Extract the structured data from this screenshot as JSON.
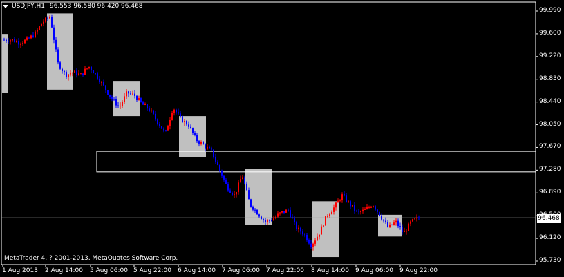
{
  "header": {
    "symbol_timeframe": "USDJPY,H1",
    "ohlc": "96.553 96.580 96.420 96.468"
  },
  "footer": {
    "copyright": "MetaTrader 4, ? 2001-2013, MetaQuotes Software Corp."
  },
  "colors": {
    "background": "#000000",
    "bull_candle": "#ff0000",
    "bear_candle": "#0000ff",
    "grid_and_axis": "#ffffff",
    "highlight_box": "#c0c0c0"
  },
  "current_price_label": "96.468",
  "chart_data": {
    "type": "candlestick",
    "title": "USDJPY,H1",
    "y_ticks": [
      "99.990",
      "99.600",
      "99.220",
      "98.830",
      "98.440",
      "98.050",
      "97.670",
      "97.280",
      "96.890",
      "96.500",
      "96.120",
      "95.730"
    ],
    "x_ticks": [
      "1 Aug 2013",
      "2 Aug 14:00",
      "5 Aug 06:00",
      "5 Aug 22:00",
      "6 Aug 14:00",
      "7 Aug 06:00",
      "7 Aug 22:00",
      "8 Aug 14:00",
      "9 Aug 06:00",
      "9 Aug 22:00"
    ],
    "ylim": [
      95.7,
      100.1
    ],
    "current_price": 96.468,
    "support_resistance_zone": [
      97.25,
      97.6
    ],
    "price_path": [
      99.5,
      99.5,
      99.45,
      99.5,
      99.6,
      99.8,
      99.9,
      99.1,
      98.9,
      98.95,
      98.9,
      99.05,
      98.9,
      98.7,
      98.5,
      98.35,
      98.6,
      98.55,
      98.4,
      98.3,
      98.1,
      97.9,
      98.35,
      98.15,
      98.05,
      97.8,
      97.7,
      97.6,
      97.3,
      97.0,
      96.85,
      97.2,
      96.7,
      96.55,
      96.4,
      96.45,
      96.55,
      96.6,
      96.3,
      96.2,
      96.0,
      96.2,
      96.5,
      96.65,
      96.85,
      96.7,
      96.55,
      96.6,
      96.7,
      96.5,
      96.3,
      96.4,
      96.2,
      96.4,
      96.468
    ],
    "highlight_boxes": [
      {
        "from": "1 Aug 2013",
        "to": "1 Aug 2013",
        "high": 99.6,
        "low": 98.6
      },
      {
        "from": "2 Aug 14:00",
        "to": "2 Aug 14:00",
        "high": 99.95,
        "low": 98.65
      },
      {
        "from": "5 Aug 06:00",
        "to": "5 Aug 22:00",
        "high": 98.8,
        "low": 98.2
      },
      {
        "from": "6 Aug 06:00",
        "to": "6 Aug 14:00",
        "high": 98.2,
        "low": 97.5
      },
      {
        "from": "7 Aug 06:00",
        "to": "7 Aug 14:00",
        "high": 97.3,
        "low": 96.35
      },
      {
        "from": "8 Aug 14:00",
        "to": "8 Aug 14:00",
        "high": 96.75,
        "low": 95.8
      },
      {
        "from": "9 Aug 06:00",
        "to": "9 Aug 14:00",
        "high": 96.52,
        "low": 96.15
      }
    ]
  }
}
